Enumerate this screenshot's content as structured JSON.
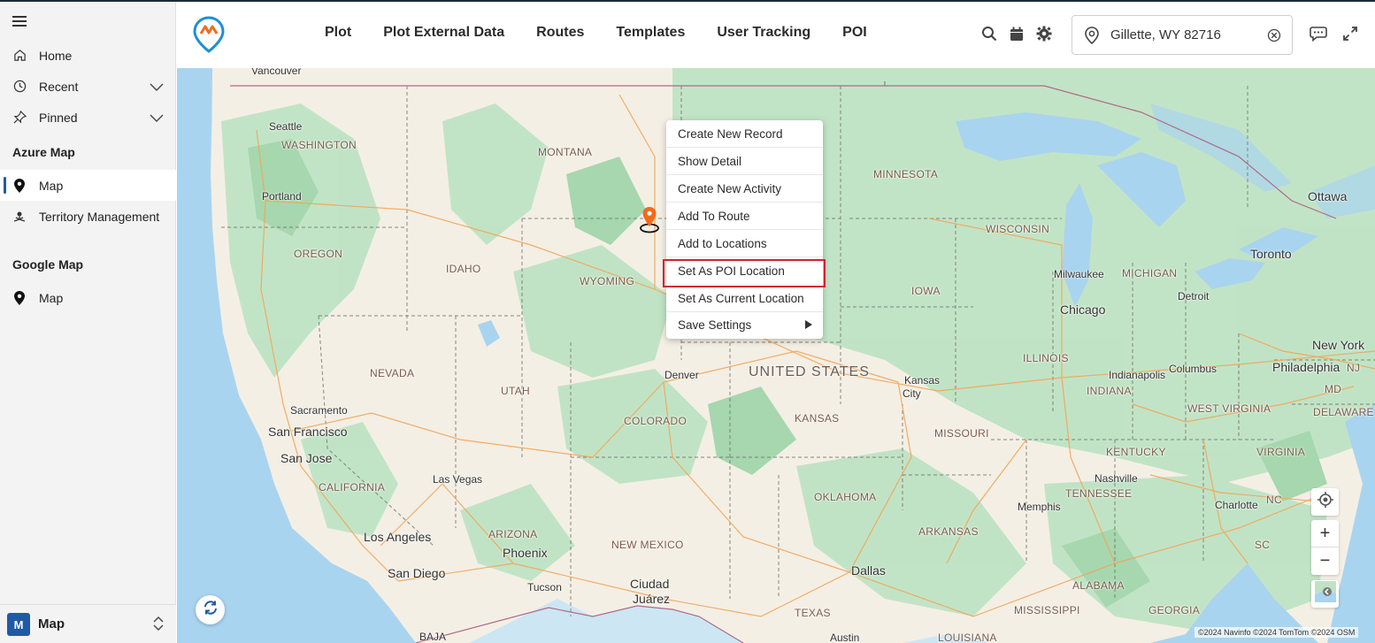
{
  "sidebar": {
    "items": [
      {
        "label": "Home",
        "icon": "home-icon"
      },
      {
        "label": "Recent",
        "icon": "clock-icon"
      },
      {
        "label": "Pinned",
        "icon": "pin-icon"
      }
    ],
    "sections": [
      {
        "title": "Azure Map",
        "items": [
          {
            "label": "Map",
            "icon": "map-pin-icon",
            "active": true
          },
          {
            "label": "Territory Management",
            "icon": "territory-icon"
          }
        ]
      },
      {
        "title": "Google Map",
        "items": [
          {
            "label": "Map",
            "icon": "map-pin-icon"
          }
        ]
      }
    ],
    "footer": {
      "badge": "M",
      "label": "Map"
    }
  },
  "header": {
    "nav": [
      "Plot",
      "Plot External Data",
      "Routes",
      "Templates",
      "User Tracking",
      "POI"
    ],
    "location": "Gillette, WY 82716"
  },
  "context_menu": {
    "items": [
      "Create New Record",
      "Show Detail",
      "Create New Activity",
      "Add To Route",
      "Add to Locations",
      "Set As POI Location",
      "Set As Current Location",
      "Save Settings"
    ],
    "highlighted": "Set As POI Location"
  },
  "map": {
    "country": "UNITED STATES",
    "labels": {
      "vancouver": "Vancouver",
      "seattle": "Seattle",
      "washington": "WASHINGTON",
      "portland": "Portland",
      "oregon": "OREGON",
      "idaho": "IDAHO",
      "montana": "MONTANA",
      "wyoming": "WYOMING",
      "nevada": "NEVADA",
      "utah": "UTAH",
      "colorado": "COLORADO",
      "california": "CALIFORNIA",
      "arizona": "ARIZONA",
      "newmexico": "NEW MEXICO",
      "sacramento": "Sacramento",
      "sanfrancisco": "San Francisco",
      "sanjose": "San Jose",
      "lasvegas": "Las Vegas",
      "losangeles": "Los Angeles",
      "sandiego": "San Diego",
      "phoenix": "Phoenix",
      "tucson": "Tucson",
      "ciudad": "Ciudad",
      "juarez": "Juárez",
      "denver": "Denver",
      "minnesota": "MINNESOTA",
      "wisconsin": "WISCONSIN",
      "iowa": "IOWA",
      "kansas": "KANSAS",
      "kansascity1": "Kansas",
      "kansascity2": "City",
      "missouri": "MISSOURI",
      "oklahoma": "OKLAHOMA",
      "arkansas": "ARKANSAS",
      "texas": "TEXAS",
      "dallas": "Dallas",
      "austin": "Austin",
      "louisiana": "LOUISIANA",
      "mississippi": "MISSISSIPPI",
      "alabama": "ALABAMA",
      "georgia": "GEORGIA",
      "tennessee": "TENNESSEE",
      "memphis": "Memphis",
      "nashville": "Nashville",
      "kentucky": "KENTUCKY",
      "illinois": "ILLINOIS",
      "indiana": "INDIANA",
      "indianapolis": "Indianapolis",
      "columbus": "Columbus",
      "chicago": "Chicago",
      "milwaukee": "Milwaukee",
      "michigan": "MICHIGAN",
      "detroit": "Detroit",
      "toronto": "Toronto",
      "ottawa": "Ottawa",
      "newyork": "New York",
      "philadelphia": "Philadelphia",
      "md": "MD",
      "westvirginia": "WEST VIRGINIA",
      "delaware": "DELAWARE",
      "virginia": "VIRGINIA",
      "charlotte": "Charlotte",
      "nc": "NC",
      "sc": "SC",
      "nj": "NJ",
      "baja": "BAJA"
    },
    "copyright": "©2024 Navinfo ©2024 TomTom ©2024 OSM"
  },
  "colors": {
    "accent": "#1f5aa6",
    "highlight": "#d3212d",
    "marker": "#f26a1b"
  }
}
